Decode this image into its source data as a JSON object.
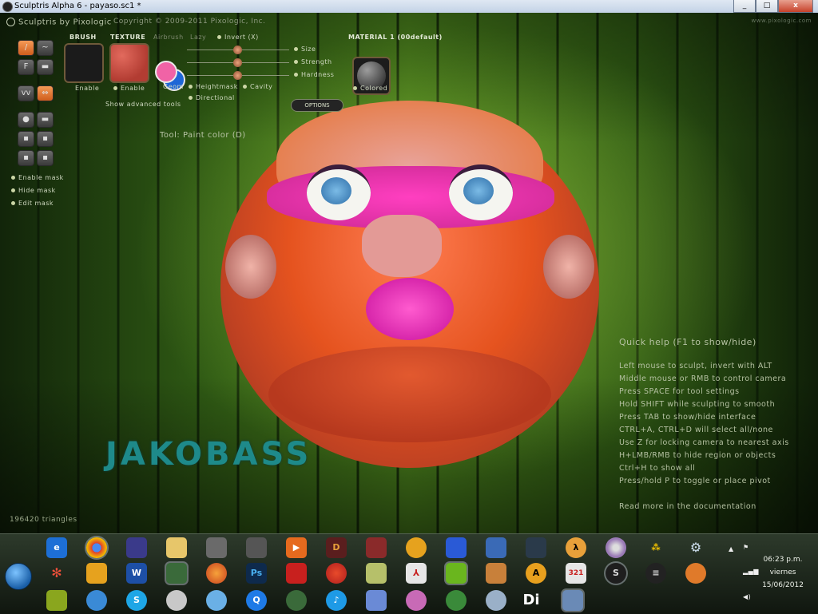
{
  "window": {
    "title": "Sculptris Alpha 6 - payaso.sc1 *",
    "btn_min": "_",
    "btn_max": "□",
    "btn_close": "x"
  },
  "app": {
    "name": "Sculptris by Pixologic",
    "copyright": "Copyright © 2009-2011 Pixologic, Inc.",
    "corner_url": "www.pixologic.com"
  },
  "toolbar": {
    "brush_label": "BRUSH",
    "texture_label": "TEXTURE",
    "airbrush_label": "Airbrush",
    "lazy_label": "Lazy",
    "invert_label": "Invert (X)",
    "size_label": "Size",
    "strength_label": "Strength",
    "hardness_label": "Hardness",
    "material_label": "MATERIAL 1 (00default)",
    "enable_brush": "Enable",
    "enable_texture": "Enable",
    "geom_label": "Geom",
    "heightmask_label": "Heightmask",
    "cavity_label": "Cavity",
    "directional_label": "Directional",
    "show_advanced": "Show advanced tools",
    "options_label": "OPTIONS",
    "colored_label": "Colored"
  },
  "tool_buttons": [
    "paint-brush",
    "smudge",
    "fill",
    "mask-paint",
    "pattern",
    "swap-colors",
    "sphere",
    "flatten",
    "grid-a",
    "grid-b",
    "grid-c",
    "grid-d"
  ],
  "mask_menu": [
    "Enable mask",
    "Hide mask",
    "Edit mask"
  ],
  "tool_info": "Tool: Paint color (D)",
  "watermark": "JAKOBASS",
  "triangles": "196420 triangles",
  "quick_help": {
    "title": "Quick help (F1 to show/hide)",
    "lines": [
      "Left mouse to sculpt, invert with ALT",
      "Middle mouse or RMB to control camera",
      "Press SPACE for tool settings",
      "Hold SHIFT while sculpting to smooth",
      "Press TAB to show/hide interface",
      "CTRL+A, CTRL+D will select all/none",
      "Use Z for locking camera to nearest axis",
      "H+LMB/RMB to hide region or objects",
      "Ctrl+H to show all",
      "Press/hold P to toggle or place pivot"
    ],
    "docs": "Read more in the documentation"
  },
  "taskbar": {
    "clock_time": "06:23 p.m.",
    "clock_day": "viernes",
    "clock_date": "15/06/2012",
    "icons_row1": [
      "ie-icon",
      "chrome-icon",
      "winrar-icon",
      "folder-icon",
      "counter-strike-icon",
      "counter-strike-icon-2",
      "media-player-icon",
      "diablo-icon",
      "game-icon",
      "pacman-icon",
      "sonic-icon",
      "game-icon-2",
      "game-icon-3",
      "half-life-icon",
      "dvd-icon",
      "dots-icon",
      "settings-icon"
    ],
    "icons_row2": [
      "molecule-icon",
      "puzzle-icon",
      "word-icon",
      "network-icon",
      "firefox-icon",
      "photoshop-icon",
      "acrobat-icon",
      "ccleaner-icon",
      "photo-icon",
      "pdf-icon",
      "nvidia-icon",
      "package-icon",
      "avast-icon",
      "calendar-icon",
      "sculptris-icon",
      "globe-icon",
      "baseball-icon"
    ],
    "icons_row3": [
      "game-icon-4",
      "skype-chat-icon",
      "skype-icon",
      "robot-icon",
      "messenger-icon",
      "quicktime-icon",
      "android-icon",
      "itunes-icon",
      "globe-icon-2",
      "mascot-icon",
      "globe-icon-3",
      "webcam-icon",
      "di-icon",
      "paint-icon"
    ],
    "di_label": "Di",
    "ps_label": "Ps",
    "w_label": "W"
  }
}
